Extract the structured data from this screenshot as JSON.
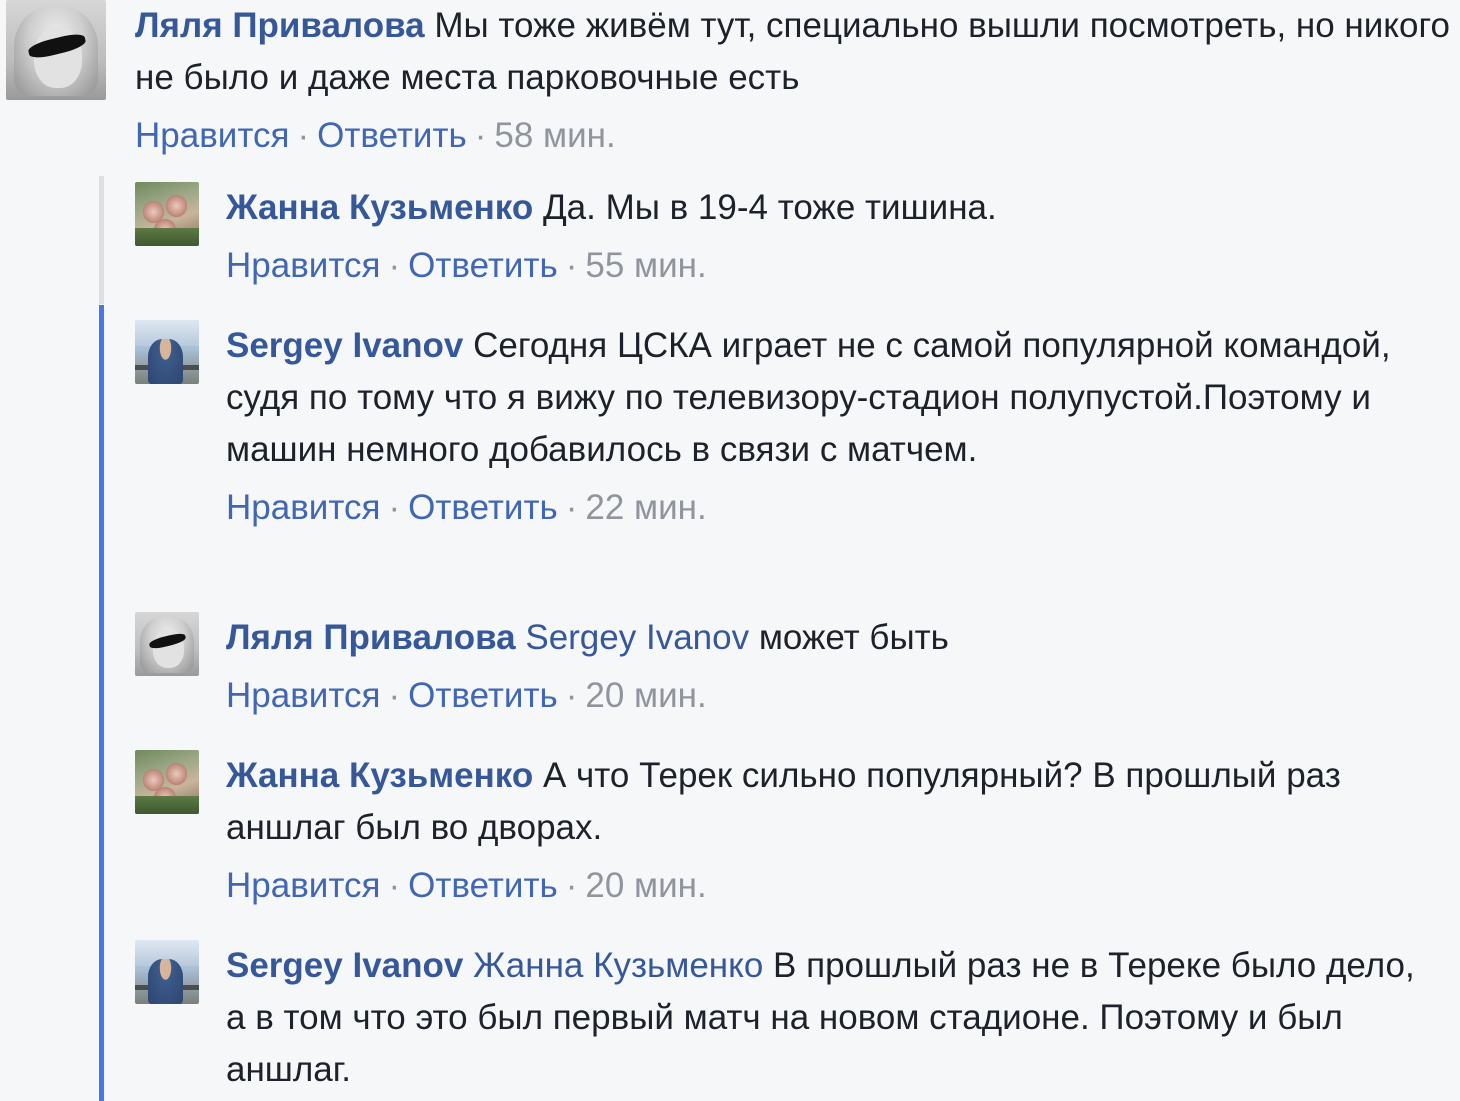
{
  "actions": {
    "like": "Нравится",
    "reply": "Ответить",
    "separator": "·"
  },
  "colors": {
    "background": "#f6f7f9",
    "author": "#365899",
    "link": "#4267b2",
    "meta": "#90949c",
    "thread_gray": "#dddfe2",
    "thread_blue": "#4a76e8"
  },
  "top_comment": {
    "author": "Ляля Привалова",
    "text": "Мы тоже живём тут, специально вышли посмотреть, но никого не было и даже места парковочные есть",
    "time": "58 мин.",
    "avatar": "lyalya-avatar"
  },
  "replies": [
    {
      "author": "Жанна Кузьменко",
      "mention": "",
      "text": "Да. Мы в 19-4 тоже тишина.",
      "time": "55 мин.",
      "avatar": "zhanna-avatar"
    },
    {
      "author": "Sergey Ivanov",
      "mention": "",
      "text": "Сегодня ЦСКА играет не с самой популярной командой, судя по тому что я вижу по телевизору-стадион полупустой.Поэтому и машин немного добавилось в связи с матчем.",
      "time": "22 мин.",
      "avatar": "sergey-avatar"
    },
    {
      "author": "Ляля Привалова",
      "mention": "Sergey Ivanov",
      "text": "может быть",
      "time": "20 мин.",
      "avatar": "lyalya-avatar"
    },
    {
      "author": "Жанна Кузьменко",
      "mention": "",
      "text": "А что Терек сильно популярный? В прошлый раз аншлаг был во дворах.",
      "time": "20 мин.",
      "avatar": "zhanna-avatar"
    },
    {
      "author": "Sergey Ivanov",
      "mention": "Жанна Кузьменко",
      "text": "В прошлый раз не в Тереке было дело, а в том что это был первый матч на новом стадионе. Поэтому и был аншлаг.",
      "time": "",
      "avatar": "sergey-avatar"
    }
  ]
}
